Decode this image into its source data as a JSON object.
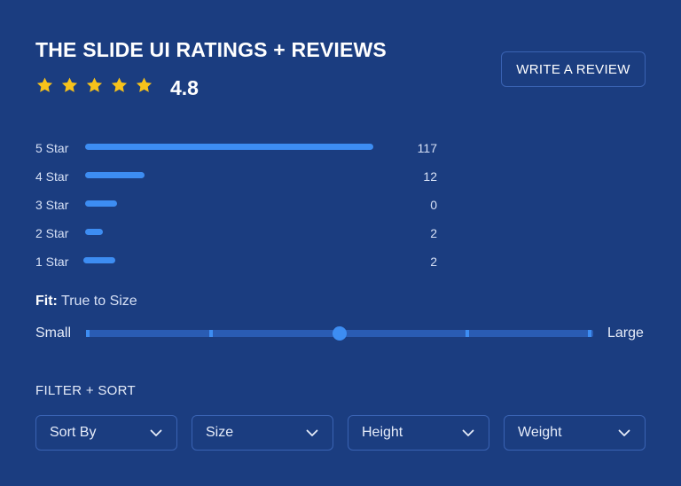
{
  "header": {
    "title": "THE SLIDE UI RATINGS + REVIEWS",
    "average": "4.8",
    "stars": 5,
    "star_color": "#f6c21b",
    "write_review_label": "WRITE A REVIEW"
  },
  "ratings": [
    {
      "label": "5 Star",
      "count": "117"
    },
    {
      "label": "4 Star",
      "count": "12"
    },
    {
      "label": "3 Star",
      "count": "0"
    },
    {
      "label": "2 Star",
      "count": "2"
    },
    {
      "label": "1 Star",
      "count": "2"
    }
  ],
  "fit": {
    "label": "Fit:",
    "value": "True to Size",
    "min_label": "Small",
    "max_label": "Large",
    "slider_position": 0.5,
    "steps": 5
  },
  "filter": {
    "title": "FILTER + SORT",
    "dropdowns": [
      {
        "label": "Sort By",
        "icon": "chevron-down-icon"
      },
      {
        "label": "Size",
        "icon": "chevron-down-icon"
      },
      {
        "label": "Height",
        "icon": "chevron-down-icon"
      },
      {
        "label": "Weight",
        "icon": "chevron-down-icon"
      }
    ]
  },
  "colors": {
    "background": "#1b3d80",
    "accent": "#3d8df2",
    "border": "#3a63b3"
  }
}
